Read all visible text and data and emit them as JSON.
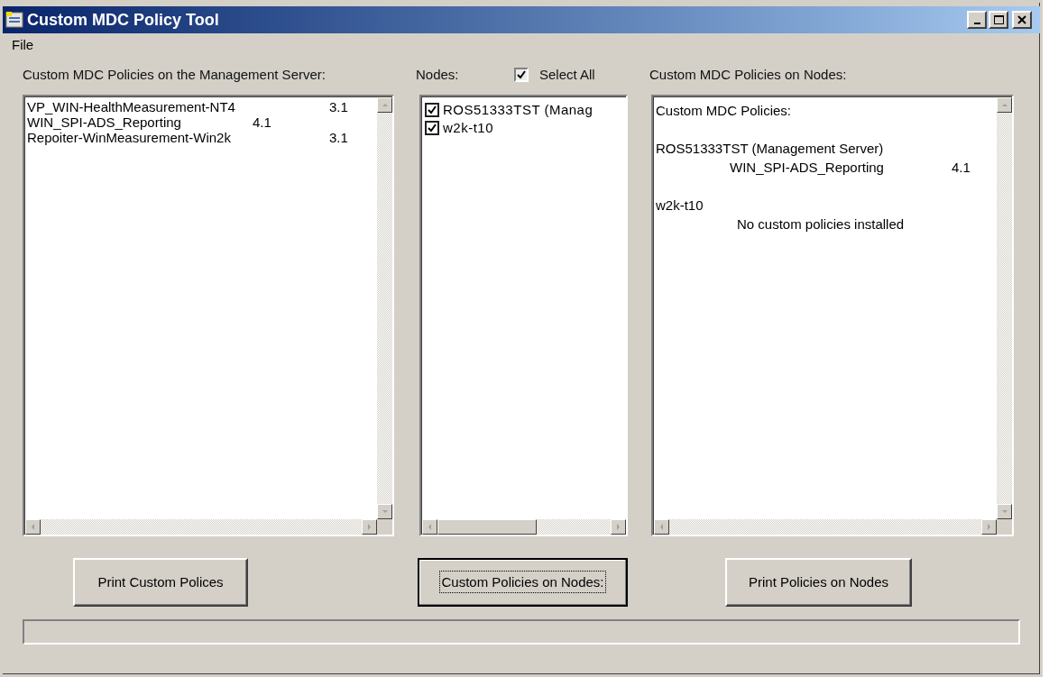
{
  "window": {
    "title": "Custom MDC Policy Tool"
  },
  "menu": [
    {
      "label": "File"
    }
  ],
  "server_policies": {
    "label": "Custom MDC Policies on the Management Server:",
    "items": [
      {
        "name": "VP_WIN-HealthMeasurement-NT4",
        "version": "3.1"
      },
      {
        "name": "WIN_SPI-ADS_Reporting",
        "version": "4.1"
      },
      {
        "name": "Repoiter-WinMeasurement-Win2k",
        "version": "3.1"
      }
    ]
  },
  "nodes": {
    "label": "Nodes:",
    "select_all": {
      "label": "Select All",
      "checked": true
    },
    "items": [
      {
        "name": "ROS51333TST (Manag",
        "checked": true
      },
      {
        "name": "w2k-t10",
        "checked": true
      }
    ]
  },
  "node_policies": {
    "label": "Custom MDC Policies on Nodes:",
    "heading": "Custom MDC Policies:",
    "nodes": [
      {
        "name": "ROS51333TST (Management Server)",
        "entries": [
          {
            "name": "WIN_SPI-ADS_Reporting",
            "version": "4.1"
          }
        ]
      },
      {
        "name": "w2k-t10",
        "message": "No custom policies installed"
      }
    ]
  },
  "buttons": [
    {
      "label": "Print Custom Polices",
      "focused": false
    },
    {
      "label": "Custom Policies on Nodes:",
      "focused": true
    },
    {
      "label": "Print Policies on Nodes",
      "focused": false
    }
  ]
}
